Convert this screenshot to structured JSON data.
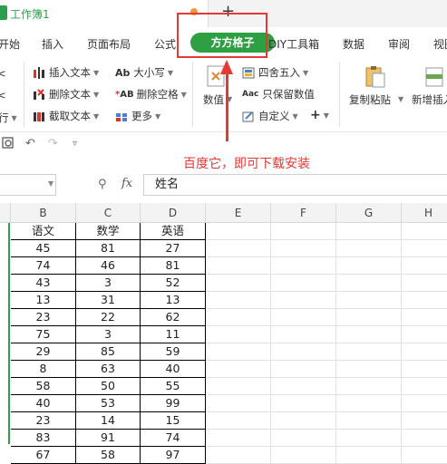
{
  "window": {
    "doc_title": "工作簿1",
    "new_tab": "+"
  },
  "menu": [
    "开始",
    "插入",
    "页面布局",
    "公式",
    "方方格子",
    "DIY工具箱",
    "数据",
    "审阅",
    "视图"
  ],
  "ribbon": {
    "left_arrows": [
      "<",
      "<",
      "行"
    ],
    "text_group": [
      "插入文本",
      "删除文本",
      "截取文本"
    ],
    "case_group": [
      "大小写",
      "删除空格",
      "更多"
    ],
    "number_label": "数值",
    "round_group": [
      "四舍五入",
      "只保留数值",
      "自定义"
    ],
    "plus": "+",
    "copy_paste": "复制粘贴",
    "new_insert": "新增插入"
  },
  "formula_bar": {
    "fx": "fx",
    "value": "姓名"
  },
  "columns": [
    "B",
    "C",
    "D",
    "E",
    "F",
    "G",
    "H"
  ],
  "table": {
    "headers": [
      "语文",
      "数学",
      "英语"
    ],
    "rows": [
      [
        "45",
        "81",
        "27"
      ],
      [
        "74",
        "46",
        "81"
      ],
      [
        "43",
        "3",
        "52"
      ],
      [
        "13",
        "31",
        "13"
      ],
      [
        "23",
        "22",
        "62"
      ],
      [
        "75",
        "3",
        "11"
      ],
      [
        "29",
        "85",
        "59"
      ],
      [
        "8",
        "63",
        "40"
      ],
      [
        "58",
        "50",
        "55"
      ],
      [
        "40",
        "53",
        "99"
      ],
      [
        "23",
        "14",
        "15"
      ],
      [
        "83",
        "91",
        "74"
      ],
      [
        "67",
        "58",
        "97"
      ]
    ]
  },
  "annotation": {
    "text": "百度它，即可下载安装",
    "color": "#e53935"
  },
  "colors": {
    "accent": "#2ea043",
    "annotation": "#e53935"
  }
}
